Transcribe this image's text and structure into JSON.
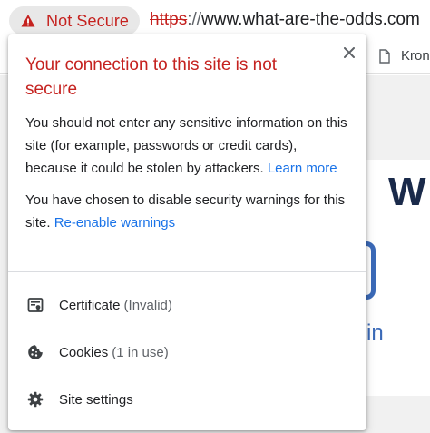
{
  "omnibox": {
    "security_label": "Not Secure",
    "url_scheme": "https",
    "url_separator": "://",
    "url_host": "www.what-are-the-odds.com"
  },
  "bookmarks": {
    "item_label": "Kron"
  },
  "page": {
    "heading_partial": "W",
    "link_partial": "in"
  },
  "popup": {
    "title": "Your connection to this site is not secure",
    "warning_text": "You should not enter any sensitive information on this site (for example, passwords or credit cards), because it could be stolen by attackers.",
    "learn_more": "Learn more",
    "disabled_text": "You have chosen to disable security warnings for this site.",
    "reenable_link": "Re-enable warnings",
    "items": [
      {
        "icon": "certificate-icon",
        "label": "Certificate",
        "detail": "(Invalid)"
      },
      {
        "icon": "cookie-icon",
        "label": "Cookies",
        "detail": "(1 in use)"
      },
      {
        "icon": "gear-icon",
        "label": "Site settings",
        "detail": ""
      }
    ]
  },
  "colors": {
    "danger": "#c5221f",
    "link": "#1a73e8",
    "chip_bg": "#e8e8e8",
    "text": "#202124",
    "secondary_text": "#5f6368"
  }
}
